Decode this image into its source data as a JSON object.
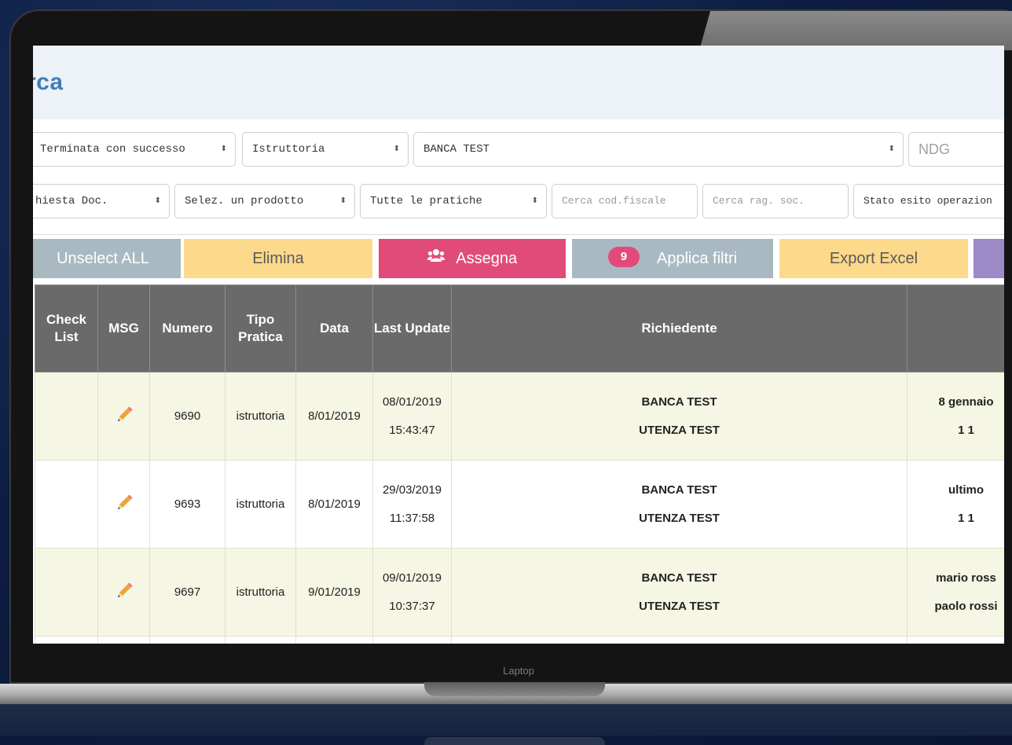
{
  "page": {
    "title": "rca"
  },
  "device": {
    "label": "Laptop"
  },
  "filters": {
    "row1": [
      {
        "name": "stato-select",
        "value": "Terminata con successo"
      },
      {
        "name": "tipo-select",
        "value": "Istruttoria"
      },
      {
        "name": "banca-select",
        "value": "BANCA TEST"
      },
      {
        "name": "ndg-input",
        "placeholder": "NDG"
      }
    ],
    "row2": [
      {
        "name": "richiesta-doc-select",
        "value": "hiesta Doc."
      },
      {
        "name": "prodotto-select",
        "value": "Selez. un prodotto"
      },
      {
        "name": "pratiche-select",
        "value": "Tutte le pratiche"
      },
      {
        "name": "cod-fiscale-input",
        "placeholder": "Cerca cod.fiscale"
      },
      {
        "name": "rag-soc-input",
        "placeholder": "Cerca rag. soc."
      },
      {
        "name": "stato-esito-select",
        "value": "Stato esito operazion"
      }
    ]
  },
  "actions": {
    "unselect_label": "Unselect ALL",
    "elimina_label": "Elimina",
    "assegna_label": "Assegna",
    "filtri_badge": "9",
    "filtri_label": "Applica filtri",
    "excel_label": "Export Excel"
  },
  "table": {
    "headers": {
      "check_list": "Check List",
      "msg": "MSG",
      "numero": "Numero",
      "tipo_pratica": "Tipo Pratica",
      "data": "Data",
      "last_update": "Last Update",
      "richiedente": "Richiedente"
    },
    "rows": [
      {
        "numero": "9690",
        "tipo": "istruttoria",
        "data": "8/01/2019",
        "last_date": "08/01/2019",
        "last_time": "15:43:47",
        "banca": "BANCA TEST",
        "utenza": "UTENZA TEST",
        "extra1": "8 gennaio",
        "extra2": "1 1"
      },
      {
        "numero": "9693",
        "tipo": "istruttoria",
        "data": "8/01/2019",
        "last_date": "29/03/2019",
        "last_time": "11:37:58",
        "banca": "BANCA TEST",
        "utenza": "UTENZA TEST",
        "extra1": "ultimo",
        "extra2": "1 1"
      },
      {
        "numero": "9697",
        "tipo": "istruttoria",
        "data": "9/01/2019",
        "last_date": "09/01/2019",
        "last_time": "10:37:37",
        "banca": "BANCA TEST",
        "utenza": "UTENZA TEST",
        "extra1": "mario ross",
        "extra2": "paolo rossi"
      }
    ]
  },
  "colors": {
    "header_bg": "#edf1f8",
    "title": "#3e7fb8",
    "table_header": "#6b6a6b",
    "row_alt": "#f6f6e4",
    "pink": "#e14b7a",
    "yellow": "#fcd98b",
    "grey_blue": "#a9b9c2",
    "purple": "#9c8ac8"
  }
}
